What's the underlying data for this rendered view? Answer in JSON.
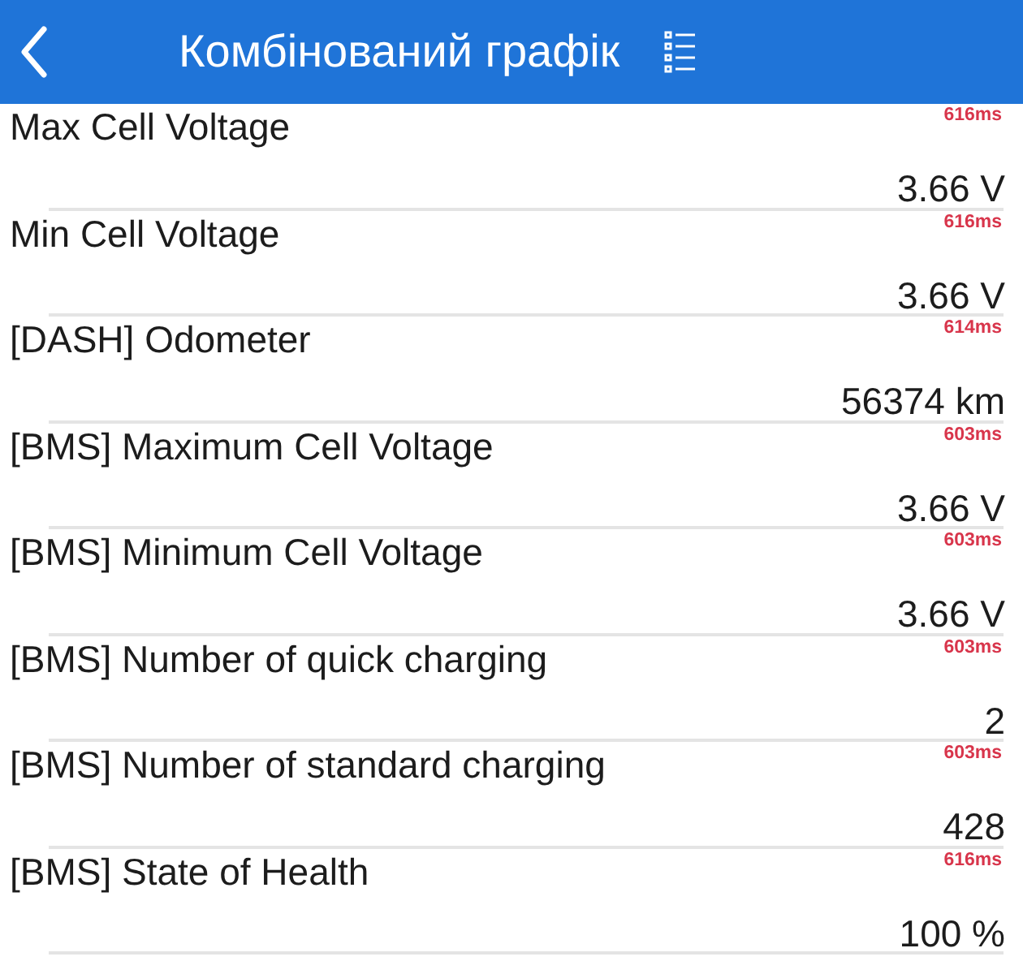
{
  "header": {
    "title": "Комбінований графік"
  },
  "rows": [
    {
      "label": "Max Cell Voltage",
      "interval": "616ms",
      "value": "3.66 V"
    },
    {
      "label": "Min Cell Voltage",
      "interval": "616ms",
      "value": "3.66 V"
    },
    {
      "label": "[DASH] Odometer",
      "interval": "614ms",
      "value": "56374 km"
    },
    {
      "label": "[BMS] Maximum Cell Voltage",
      "interval": "603ms",
      "value": "3.66 V"
    },
    {
      "label": "[BMS] Minimum Cell Voltage",
      "interval": "603ms",
      "value": "3.66 V"
    },
    {
      "label": "[BMS] Number of quick charging",
      "interval": "603ms",
      "value": "2"
    },
    {
      "label": "[BMS] Number of standard charging",
      "interval": "603ms",
      "value": "428"
    },
    {
      "label": "[BMS] State of Health",
      "interval": "616ms",
      "value": "100 %"
    }
  ]
}
